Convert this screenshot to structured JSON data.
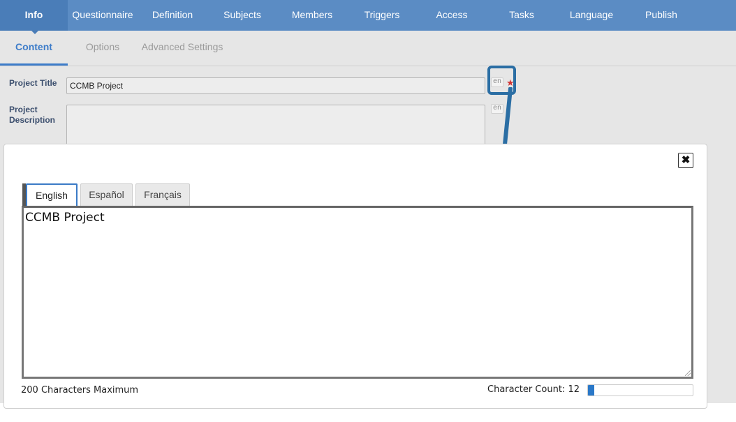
{
  "top_nav": {
    "items": [
      "Info",
      "Questionnaire",
      "Definition",
      "Subjects",
      "Members",
      "Triggers",
      "Access",
      "Tasks",
      "Language",
      "Publish"
    ],
    "active": "Info"
  },
  "sub_nav": {
    "items": [
      "Content",
      "Options",
      "Advanced Settings"
    ],
    "active": "Content"
  },
  "form": {
    "title_label": "Project Title",
    "title_value": "CCMB Project",
    "title_lang": "en",
    "required_mark": "★",
    "desc_label_1": "Project",
    "desc_label_2": "Description",
    "desc_lang": "en"
  },
  "modal": {
    "close_label": "✖",
    "tabs": [
      "English",
      "Español",
      "Français"
    ],
    "active_tab": "English",
    "text_value": "CCMB Project",
    "max_label": "200 Characters Maximum",
    "count_label": "Character Count:",
    "count_value": "12",
    "max_chars": 200,
    "count_fraction": 0.06
  },
  "colors": {
    "nav_bg": "#5b8cc4",
    "nav_active": "#4a7db8",
    "accent": "#3d7cc9",
    "callout": "#2b6ea4",
    "required": "#d13434"
  }
}
